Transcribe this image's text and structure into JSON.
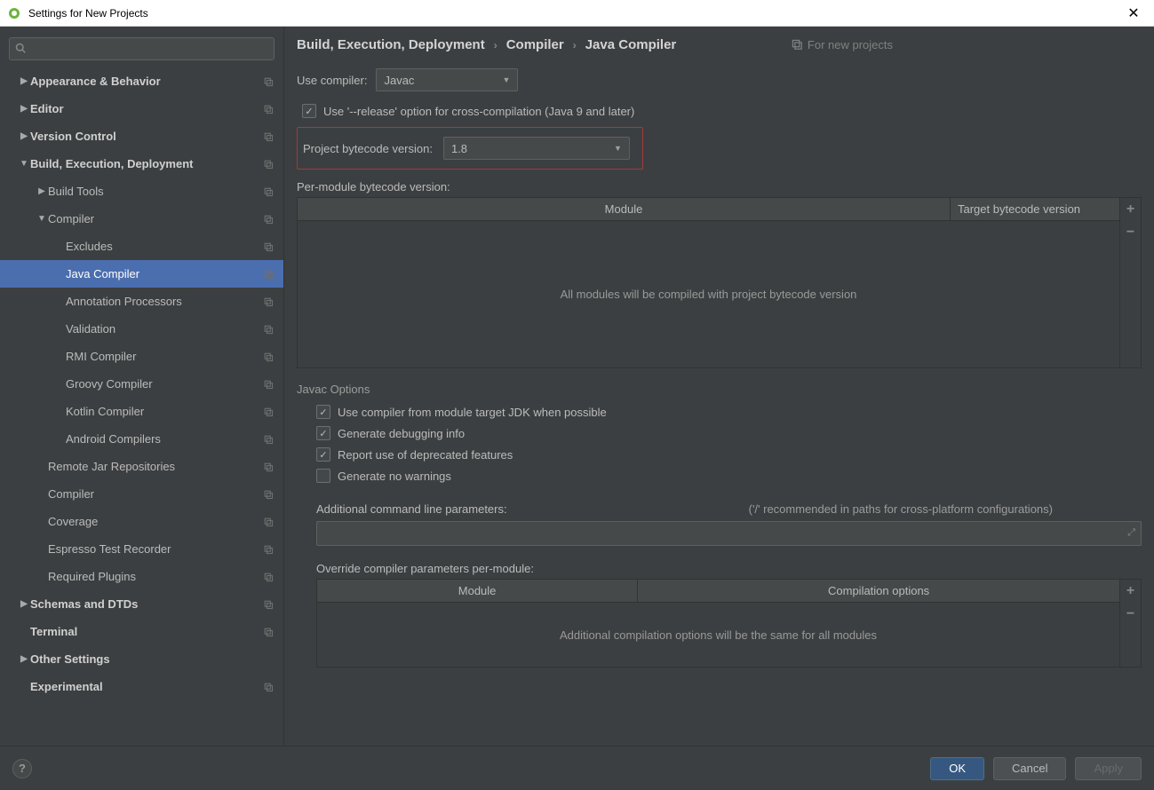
{
  "window": {
    "title": "Settings for New Projects"
  },
  "search": {
    "placeholder": ""
  },
  "sidebar": {
    "items": [
      {
        "label": "Appearance & Behavior",
        "indent": 0,
        "arrow": "right",
        "bold": true,
        "cfg": true
      },
      {
        "label": "Editor",
        "indent": 0,
        "arrow": "right",
        "bold": true,
        "cfg": true
      },
      {
        "label": "Version Control",
        "indent": 0,
        "arrow": "right",
        "bold": true,
        "cfg": true
      },
      {
        "label": "Build, Execution, Deployment",
        "indent": 0,
        "arrow": "down",
        "bold": true,
        "cfg": true
      },
      {
        "label": "Build Tools",
        "indent": 1,
        "arrow": "right",
        "bold": false,
        "cfg": true
      },
      {
        "label": "Compiler",
        "indent": 1,
        "arrow": "down",
        "bold": false,
        "cfg": true
      },
      {
        "label": "Excludes",
        "indent": 2,
        "arrow": "",
        "bold": false,
        "cfg": true
      },
      {
        "label": "Java Compiler",
        "indent": 2,
        "arrow": "",
        "bold": false,
        "cfg": true,
        "selected": true
      },
      {
        "label": "Annotation Processors",
        "indent": 2,
        "arrow": "",
        "bold": false,
        "cfg": true
      },
      {
        "label": "Validation",
        "indent": 2,
        "arrow": "",
        "bold": false,
        "cfg": true
      },
      {
        "label": "RMI Compiler",
        "indent": 2,
        "arrow": "",
        "bold": false,
        "cfg": true
      },
      {
        "label": "Groovy Compiler",
        "indent": 2,
        "arrow": "",
        "bold": false,
        "cfg": true
      },
      {
        "label": "Kotlin Compiler",
        "indent": 2,
        "arrow": "",
        "bold": false,
        "cfg": true
      },
      {
        "label": "Android Compilers",
        "indent": 2,
        "arrow": "",
        "bold": false,
        "cfg": true
      },
      {
        "label": "Remote Jar Repositories",
        "indent": 1,
        "arrow": "",
        "bold": false,
        "cfg": true
      },
      {
        "label": "Compiler",
        "indent": 1,
        "arrow": "",
        "bold": false,
        "cfg": true
      },
      {
        "label": "Coverage",
        "indent": 1,
        "arrow": "",
        "bold": false,
        "cfg": true
      },
      {
        "label": "Espresso Test Recorder",
        "indent": 1,
        "arrow": "",
        "bold": false,
        "cfg": true
      },
      {
        "label": "Required Plugins",
        "indent": 1,
        "arrow": "",
        "bold": false,
        "cfg": true
      },
      {
        "label": "Schemas and DTDs",
        "indent": 0,
        "arrow": "right",
        "bold": true,
        "cfg": true
      },
      {
        "label": "Terminal",
        "indent": 0,
        "arrow": "",
        "bold": true,
        "cfg": true
      },
      {
        "label": "Other Settings",
        "indent": 0,
        "arrow": "right",
        "bold": true,
        "cfg": false
      },
      {
        "label": "Experimental",
        "indent": 0,
        "arrow": "",
        "bold": true,
        "cfg": true
      }
    ]
  },
  "breadcrumb": {
    "p1": "Build, Execution, Deployment",
    "p2": "Compiler",
    "p3": "Java Compiler"
  },
  "for_new": "For new projects",
  "form": {
    "use_compiler_label": "Use compiler:",
    "use_compiler_value": "Javac",
    "release_option": "Use '--release' option for cross-compilation (Java 9 and later)",
    "project_bytecode_label": "Project bytecode version:",
    "project_bytecode_value": "1.8",
    "per_module_label": "Per-module bytecode version:"
  },
  "table1": {
    "col1": "Module",
    "col2": "Target bytecode version",
    "empty": "All modules will be compiled with project bytecode version"
  },
  "javac": {
    "title": "Javac Options",
    "opt1": "Use compiler from module target JDK when possible",
    "opt2": "Generate debugging info",
    "opt3": "Report use of deprecated features",
    "opt4": "Generate no warnings",
    "addl_label": "Additional command line parameters:",
    "addl_hint": "('/' recommended in paths for cross-platform configurations)",
    "override_label": "Override compiler parameters per-module:"
  },
  "table2": {
    "col1": "Module",
    "col2": "Compilation options",
    "empty": "Additional compilation options will be the same for all modules"
  },
  "footer": {
    "ok": "OK",
    "cancel": "Cancel",
    "apply": "Apply"
  }
}
